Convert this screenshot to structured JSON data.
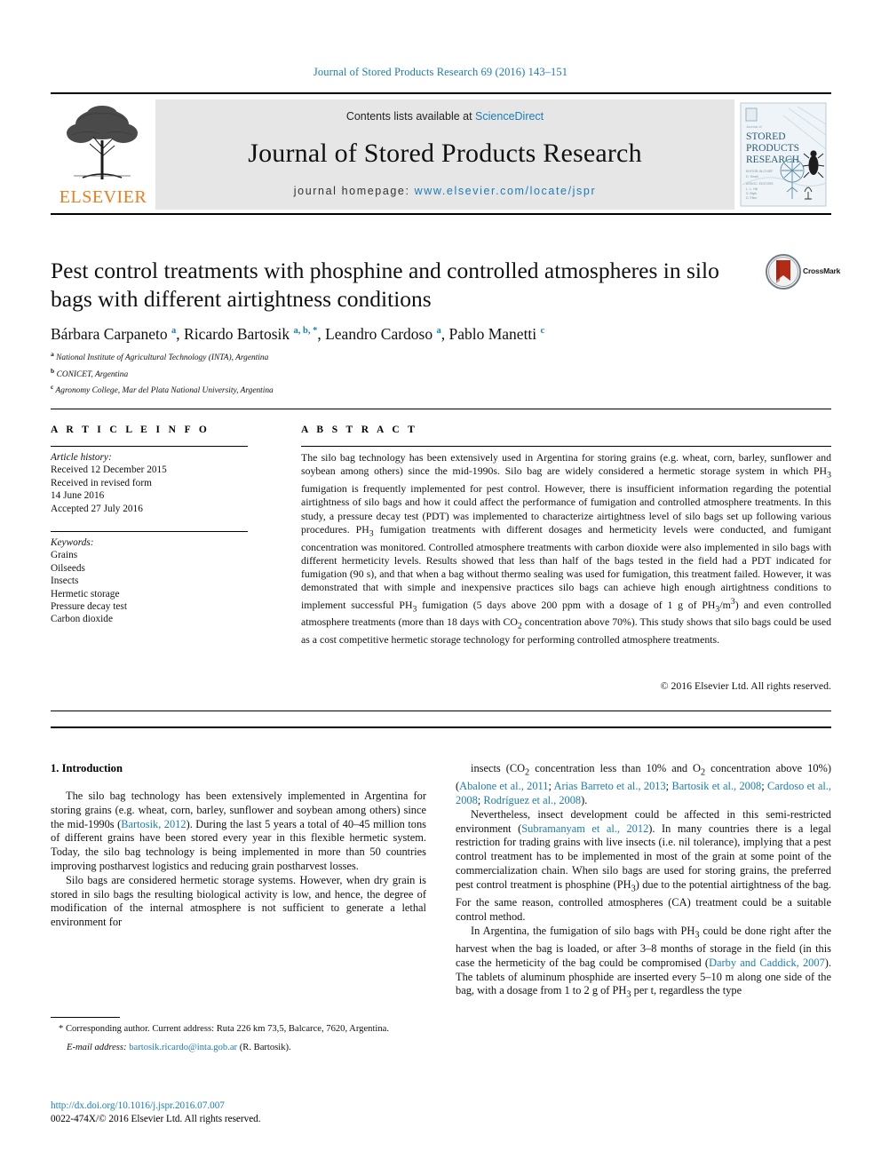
{
  "running_head": "Journal of Stored Products Research 69 (2016) 143–151",
  "masthead": {
    "contents_prefix": "Contents lists available at ",
    "sciencedirect": "ScienceDirect",
    "journal_title": "Journal of Stored Products Research",
    "homepage_prefix": "journal homepage: ",
    "homepage_url": "www.elsevier.com/locate/jspr",
    "publisher": "ELSEVIER",
    "cover_lines": [
      "STORED",
      "PRODUCTS",
      "RESEARCH"
    ]
  },
  "crossmark": {
    "label": "CrossMark"
  },
  "article": {
    "title": "Pest control treatments with phosphine and controlled atmospheres in silo bags with different airtightness conditions",
    "authors_html": "Bárbara Carpaneto <sup>a</sup>, Ricardo Bartosik <sup>a, b, *</sup>, Leandro Cardoso <sup>a</sup>, Pablo Manetti <sup>c</sup>",
    "affiliations": [
      {
        "mark": "a",
        "text": "National Institute of Agricultural Technology (INTA), Argentina"
      },
      {
        "mark": "b",
        "text": "CONICET, Argentina"
      },
      {
        "mark": "c",
        "text": "Agronomy College, Mar del Plata National University, Argentina"
      }
    ]
  },
  "info": {
    "heading": "A R T I C L E   I N F O",
    "history_label": "Article history:",
    "history": [
      "Received 12 December 2015",
      "Received in revised form",
      "14 June 2016",
      "Accepted 27 July 2016"
    ],
    "keywords_label": "Keywords:",
    "keywords": [
      "Grains",
      "Oilseeds",
      "Insects",
      "Hermetic storage",
      "Pressure decay test",
      "Carbon dioxide"
    ]
  },
  "abstract": {
    "heading": "A B S T R A C T",
    "text": "The silo bag technology has been extensively used in Argentina for storing grains (e.g. wheat, corn, barley, sunflower and soybean among others) since the mid-1990s. Silo bag are widely considered a hermetic storage system in which PH₃ fumigation is frequently implemented for pest control. However, there is insufficient information regarding the potential airtightness of silo bags and how it could affect the performance of fumigation and controlled atmosphere treatments. In this study, a pressure decay test (PDT) was implemented to characterize airtightness level of silo bags set up following various procedures. PH₃ fumigation treatments with different dosages and hermeticity levels were conducted, and fumigant concentration was monitored. Controlled atmosphere treatments with carbon dioxide were also implemented in silo bags with different hermeticity levels. Results showed that less than half of the bags tested in the field had a PDT indicated for fumigation (90 s), and that when a bag without thermo sealing was used for fumigation, this treatment failed. However, it was demonstrated that with simple and inexpensive practices silo bags can achieve high enough airtightness conditions to implement successful PH₃ fumigation (5 days above 200 ppm with a dosage of 1 g of PH₃/m³) and even controlled atmosphere treatments (more than 18 days with CO₂ concentration above 70%). This study shows that silo bags could be used as a cost competitive hermetic storage technology for performing controlled atmosphere treatments.",
    "copyright": "© 2016 Elsevier Ltd. All rights reserved."
  },
  "body": {
    "section_number_title": "1.  Introduction",
    "left_paragraphs": [
      "The silo bag technology has been extensively implemented in Argentina for storing grains (e.g. wheat, corn, barley, sunflower and soybean among others) since the mid-1990s (Bartosik, 2012). During the last 5 years a total of 40–45 million tons of different grains have been stored every year in this flexible hermetic system. Today, the silo bag technology is being implemented in more than 50 countries improving postharvest logistics and reducing grain postharvest losses.",
      "Silo bags are considered hermetic storage systems. However, when dry grain is stored in silo bags the resulting biological activity is low, and hence, the degree of modification of the internal atmosphere is not sufficient to generate a lethal environment for"
    ],
    "right_paragraphs": [
      "insects (CO₂ concentration less than 10% and O₂ concentration above 10%) (Abalone et al., 2011; Arias Barreto et al., 2013; Bartosik et al., 2008; Cardoso et al., 2008; Rodríguez et al., 2008).",
      "Nevertheless, insect development could be affected in this semi-restricted environment (Subramanyam et al., 2012). In many countries there is a legal restriction for trading grains with live insects (i.e. nil tolerance), implying that a pest control treatment has to be implemented in most of the grain at some point of the commercialization chain. When silo bags are used for storing grains, the preferred pest control treatment is phosphine (PH₃) due to the potential airtightness of the bag. For the same reason, controlled atmospheres (CA) treatment could be a suitable control method.",
      "In Argentina, the fumigation of silo bags with PH₃ could be done right after the harvest when the bag is loaded, or after 3–8 months of storage in the field (in this case the hermeticity of the bag could be compromised (Darby and Caddick, 2007). The tablets of aluminum phosphide are inserted every 5–10 m along one side of the bag, with a dosage from 1 to 2 g of PH₃ per t, regardless the type"
    ],
    "references_left": [
      "Bartosik, 2012"
    ],
    "references_right": [
      "Abalone et al., 2011",
      "Arias Barreto et al., 2013",
      "Bartosik et al., 2008",
      "Cardoso et al., 2008",
      "Rodríguez et al., 2008",
      "Subramanyam et al., 2012",
      "Darby and Caddick, 2007"
    ]
  },
  "footnote": {
    "corresponding": "* Corresponding author. Current address: Ruta 226 km 73,5, Balcarce, 7620, Argentina.",
    "email_label": "E-mail address:",
    "email": "bartosik.ricardo@inta.gob.ar",
    "email_suffix": "(R. Bartosik)."
  },
  "doi": {
    "link": "http://dx.doi.org/10.1016/j.jspr.2016.07.007",
    "issn_line": "0022-474X/© 2016 Elsevier Ltd. All rights reserved."
  },
  "colors": {
    "link_blue": "#1a7db6",
    "elsevier_orange": "#f07c19",
    "masthead_grey": "#e6e6e6",
    "crossmark_red": "#b32a17"
  }
}
